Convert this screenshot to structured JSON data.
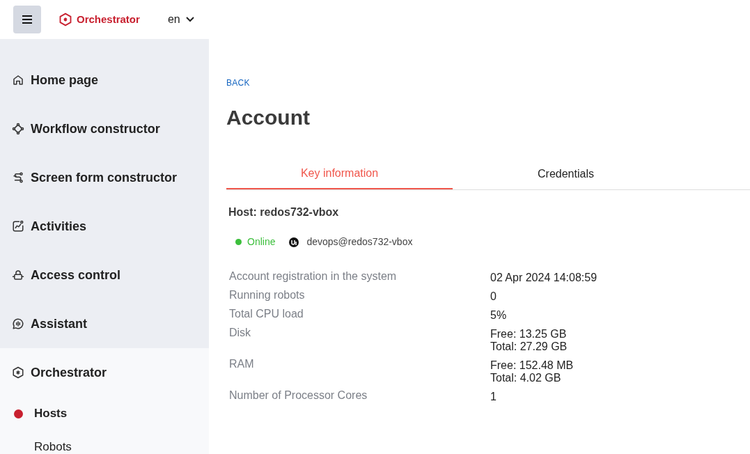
{
  "header": {
    "brand": "Orchestrator",
    "language": "en"
  },
  "sidebar": {
    "items": [
      {
        "label": "Home page",
        "expanded": false
      },
      {
        "label": "Workflow constructor",
        "expanded": false
      },
      {
        "label": "Screen form constructor",
        "expanded": false
      },
      {
        "label": "Activities",
        "expanded": false
      },
      {
        "label": "Access control",
        "expanded": false
      },
      {
        "label": "Assistant",
        "expanded": false
      },
      {
        "label": "Orchestrator",
        "expanded": true,
        "children": [
          {
            "label": "Hosts",
            "selected": true
          },
          {
            "label": "Robots",
            "selected": false
          }
        ]
      }
    ]
  },
  "back": "BACK",
  "title": "Account",
  "tabs": [
    {
      "label": "Key information",
      "selected": true
    },
    {
      "label": "Credentials",
      "selected": false
    }
  ],
  "host": "Host: redos732-vbox",
  "status": {
    "label": "Online",
    "kind": "online"
  },
  "account": "devops@redos732-vbox",
  "details": [
    {
      "label": "Account registration in the system",
      "values": [
        "02 Apr 2024 14:08:59"
      ]
    },
    {
      "label": "Running robots",
      "values": [
        "0"
      ]
    },
    {
      "label": "Total CPU load",
      "values": [
        "5%"
      ]
    },
    {
      "label": "Disk",
      "values": [
        "Free: 13.25 GB",
        "Total: 27.29 GB"
      ]
    },
    {
      "label": "RAM",
      "values": [
        "Free: 152.48 MB",
        "Total: 4.02 GB"
      ]
    },
    {
      "label": "Number of Processor Cores",
      "values": [
        "1"
      ]
    }
  ]
}
